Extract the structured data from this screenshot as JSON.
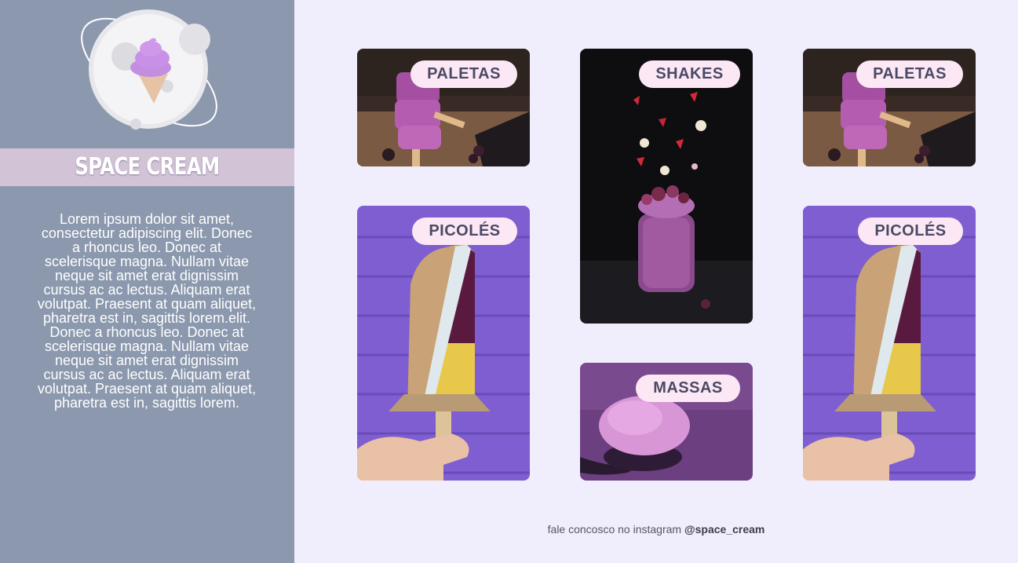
{
  "brand": {
    "name": "SPACE CREAM"
  },
  "about": {
    "text": "Lorem ipsum dolor sit amet, consectetur adipiscing elit. Donec a rhoncus leo. Donec at scelerisque magna. Nullam vitae neque sit amet erat dignissim cursus ac ac lectus. Aliquam erat volutpat. Praesent at quam aliquet, pharetra est in, sagittis lorem.elit. Donec a rhoncus leo. Donec at scelerisque magna. Nullam vitae neque sit amet erat dignissim cursus ac ac lectus. Aliquam erat volutpat. Praesent at quam aliquet, pharetra est in, sagittis lorem."
  },
  "categories": [
    {
      "label": "PALETAS"
    },
    {
      "label": "SHAKES"
    },
    {
      "label": "PALETAS"
    },
    {
      "label": "PICOLÉS"
    },
    {
      "label": "MASSAS"
    },
    {
      "label": "PICOLÉS"
    }
  ],
  "footer": {
    "text": "fale concosco no instagram ",
    "handle": "@space_cream"
  },
  "colors": {
    "sidebar": "#8b98ad",
    "brand_bar": "#d3c3d7",
    "page_background": "#f0eefc",
    "pill_background": "#fce8f4",
    "pill_text": "#4a4a66"
  }
}
